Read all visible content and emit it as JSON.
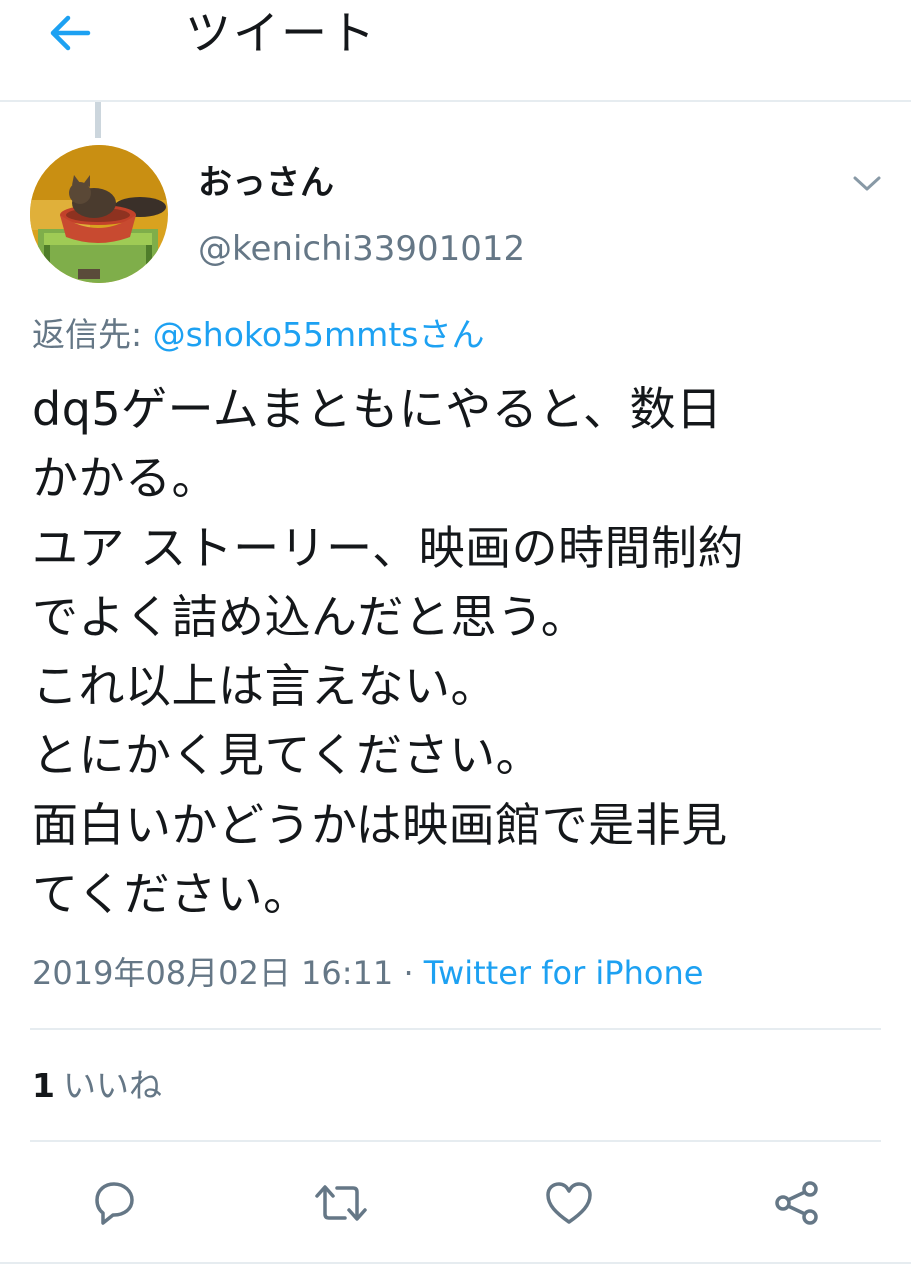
{
  "header": {
    "title": "ツイート",
    "back_icon": "arrow-left-icon",
    "accent": "#1da1f2"
  },
  "tweet": {
    "author": {
      "name": "おっさん",
      "handle": "@kenichi33901012",
      "avatar": "cat-in-basket-avatar"
    },
    "reply_to": {
      "prefix": "返信先: ",
      "mention": "@shoko55mmts",
      "suffix": "さん"
    },
    "text": "dq5ゲームまともにやると、数日\nかかる。\nユア ストーリー、映画の時間制約\nでよく詰め込んだと思う。\nこれ以上は言えない。\nとにかく見てください。\n面白いかどうかは映画館で是非見\nてください。",
    "timestamp": "2019年08月02日 16:11",
    "separator": " · ",
    "source": "Twitter for iPhone",
    "likes": {
      "count": "1",
      "label": "いいね"
    }
  },
  "actions": [
    {
      "name": "reply",
      "icon": "reply-icon"
    },
    {
      "name": "retweet",
      "icon": "retweet-icon"
    },
    {
      "name": "like",
      "icon": "heart-icon"
    },
    {
      "name": "share",
      "icon": "share-icon"
    }
  ],
  "colors": {
    "text": "#14171a",
    "secondary": "#657786",
    "link": "#1da1f2",
    "divider": "#e6ecf0"
  }
}
